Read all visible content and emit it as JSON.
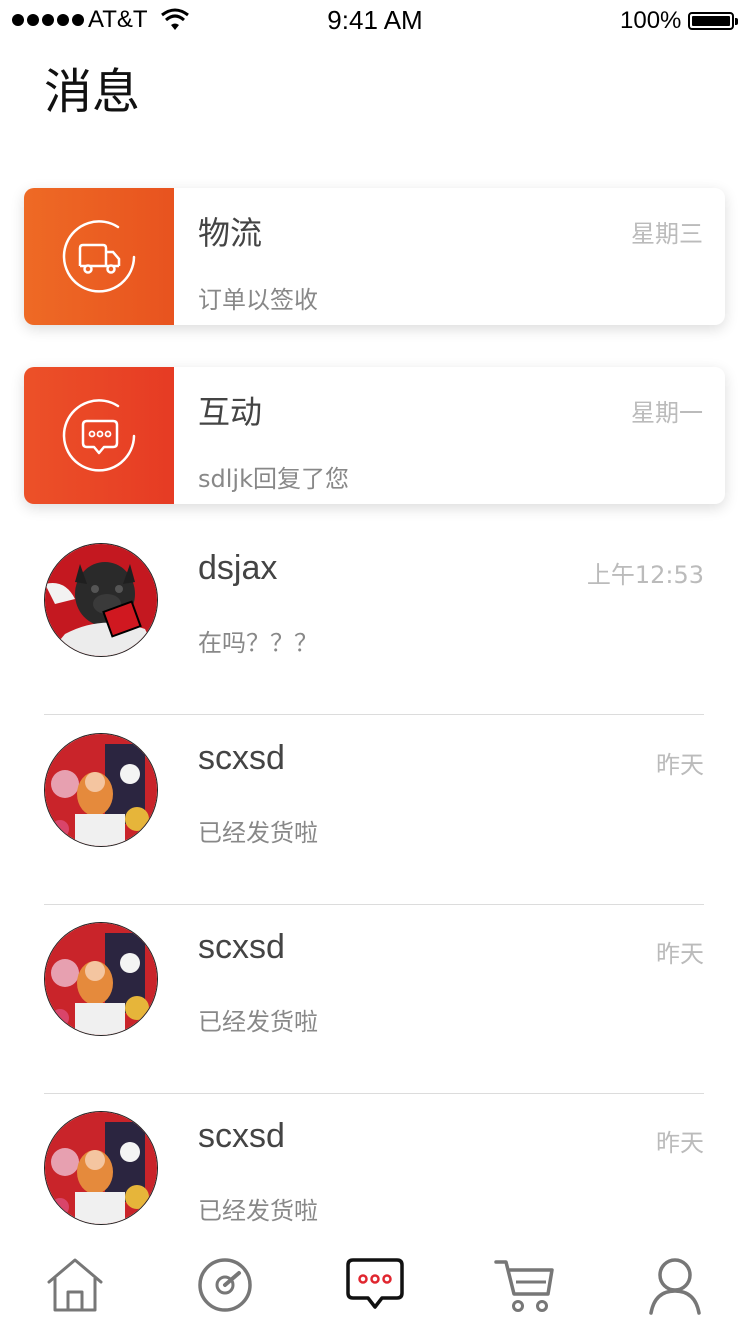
{
  "status_bar": {
    "carrier": "AT&T",
    "time": "9:41 AM",
    "battery": "100%"
  },
  "page_title": "消息",
  "cards": [
    {
      "title": "物流",
      "subtitle": "订单以签收",
      "time": "星期三",
      "icon": "truck-icon",
      "color": "#ec6224"
    },
    {
      "title": "互动",
      "subtitle": "sdljk回复了您",
      "time": "星期一",
      "icon": "chat-bubble-icon",
      "color": "#e84826"
    }
  ],
  "messages": [
    {
      "name": "dsjax",
      "preview": "在吗？？？",
      "time": "上午12:53",
      "avatar": "avatar-dog"
    },
    {
      "name": "scxsd",
      "preview": "已经发货啦",
      "time": "昨天",
      "avatar": "avatar-illustration"
    },
    {
      "name": "scxsd",
      "preview": "已经发货啦",
      "time": "昨天",
      "avatar": "avatar-illustration"
    },
    {
      "name": "scxsd",
      "preview": "已经发货啦",
      "time": "昨天",
      "avatar": "avatar-illustration"
    }
  ],
  "tab_bar": {
    "tabs": [
      {
        "icon": "home-icon",
        "active": false
      },
      {
        "icon": "discover-icon",
        "active": false
      },
      {
        "icon": "message-icon",
        "active": true
      },
      {
        "icon": "cart-icon",
        "active": false
      },
      {
        "icon": "profile-icon",
        "active": false
      }
    ],
    "active_color": "#e0262f",
    "inactive_color": "#777777"
  }
}
